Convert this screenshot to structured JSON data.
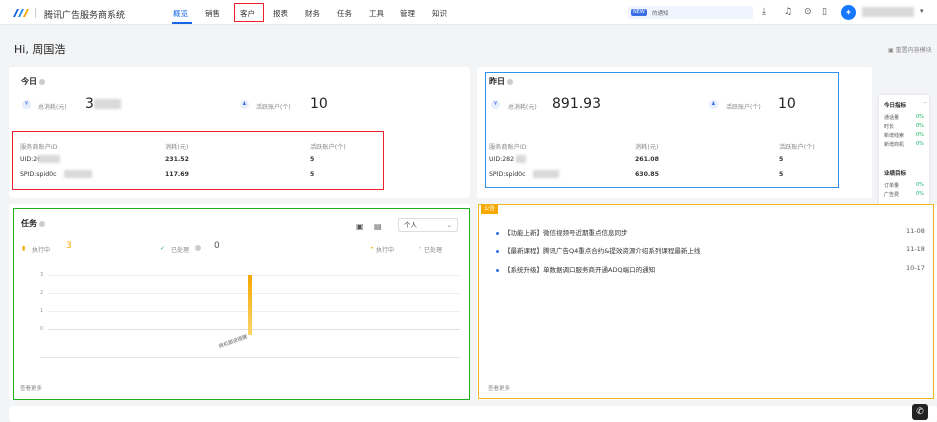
{
  "header": {
    "app_title": "腾讯广告服务商系统",
    "nav": [
      "概览",
      "销售",
      "客户",
      "报表",
      "财务",
      "任务",
      "工具",
      "管理",
      "知识"
    ],
    "active_nav": "概览",
    "notice_tag": "NEW",
    "notice_text": "的通知"
  },
  "greeting": "Hi, 周国浩",
  "rearrange": "重置内容模块",
  "today": {
    "title": "今日",
    "total_label": "总消耗(元)",
    "total_value": "3",
    "active_label": "活跃账户(个)",
    "active_value": "10",
    "table_headers": [
      "服务商账户ID",
      "消耗(元)",
      "活跃账户(个)"
    ],
    "rows": [
      {
        "id": "UID:26",
        "spend": "231.52",
        "active": "5"
      },
      {
        "id": "SPID:spid0c",
        "spend": "117.69",
        "active": "5"
      }
    ]
  },
  "yesterday": {
    "title": "昨日",
    "total_label": "总消耗(元)",
    "total_value": "891.93",
    "active_label": "活跃账户(个)",
    "active_value": "10",
    "table_headers": [
      "服务商账户ID",
      "消耗(元)",
      "活跃账户(个)"
    ],
    "rows": [
      {
        "id": "UID:282",
        "spend": "261.08",
        "active": "5"
      },
      {
        "id": "SPID:spid0c",
        "spend": "630.85",
        "active": "5"
      }
    ]
  },
  "side_panel": {
    "today_title": "今日指标",
    "today_items": [
      {
        "k": "通话量",
        "v": "0%"
      },
      {
        "k": "时长",
        "v": "0%"
      },
      {
        "k": "新增线索",
        "v": "0%"
      },
      {
        "k": "新增商机",
        "v": "0%"
      }
    ],
    "biz_title": "业绩目标",
    "biz_items": [
      {
        "k": "订单量",
        "v": "0%"
      },
      {
        "k": "广告费",
        "v": "0%"
      }
    ]
  },
  "tasks": {
    "title": "任务",
    "in_progress_label": "执行中",
    "in_progress_value": "3",
    "done_label": "已处理",
    "done_value": "0",
    "legend_in_progress": "执行中",
    "legend_done": "已处理",
    "select_value": "个人",
    "footer": "查看更多",
    "y_ticks": [
      "3",
      "2",
      "1",
      "0"
    ]
  },
  "chart_data": {
    "type": "bar",
    "categories": [
      "商机跟进提醒"
    ],
    "series": [
      {
        "name": "执行中",
        "values": [
          3
        ]
      },
      {
        "name": "已处理",
        "values": [
          0
        ]
      }
    ],
    "ylim": [
      0,
      3
    ]
  },
  "announcements": {
    "tag": "公告",
    "items": [
      {
        "text": "【功能上新】微信视频号近期重点信息同步",
        "date": "11-08"
      },
      {
        "text": "【最新课程】腾讯广告Q4重点合约&提效资源介绍系列课程最新上线",
        "date": "11-18"
      },
      {
        "text": "【系统升级】单数据调口服务商开通ADQ端口的通知",
        "date": "10-17"
      }
    ],
    "footer": "查看更多"
  },
  "colors": {
    "accent": "#1565e6",
    "red_box": "#e8212b",
    "green_box": "#1fb01f",
    "blue_box": "#2e8ff0",
    "yellow_box": "#f2b41e",
    "bar": "#f7a800"
  }
}
